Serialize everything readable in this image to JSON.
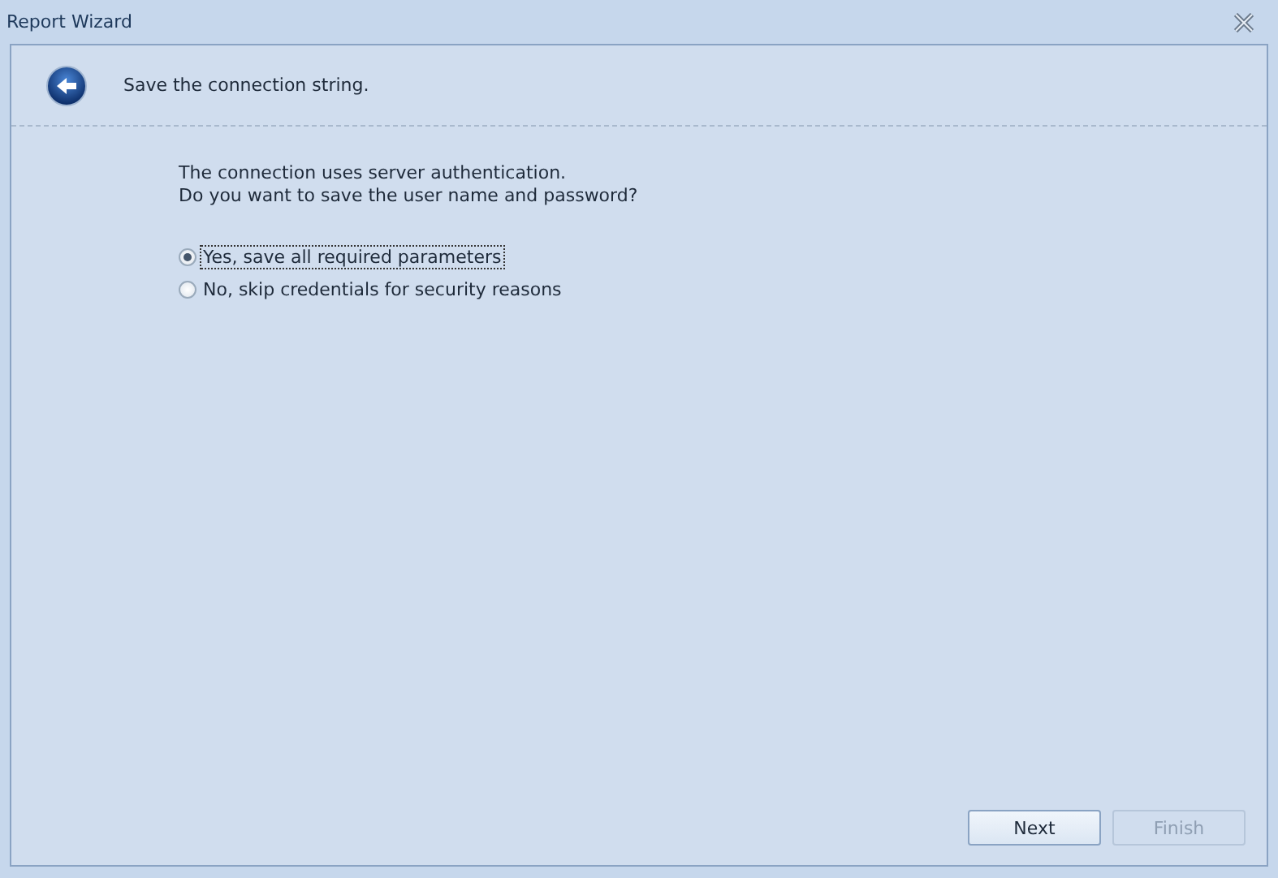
{
  "window": {
    "title": "Report Wizard"
  },
  "header": {
    "title": "Save the connection string."
  },
  "message": [
    "The connection uses server authentication.",
    "Do you want to save the user name and password?"
  ],
  "options": [
    {
      "label": "Yes, save all required parameters",
      "selected": true
    },
    {
      "label": "No, skip credentials for security reasons",
      "selected": false
    }
  ],
  "buttons": [
    {
      "label": "Next",
      "disabled": false
    },
    {
      "label": "Finish",
      "disabled": true
    }
  ]
}
